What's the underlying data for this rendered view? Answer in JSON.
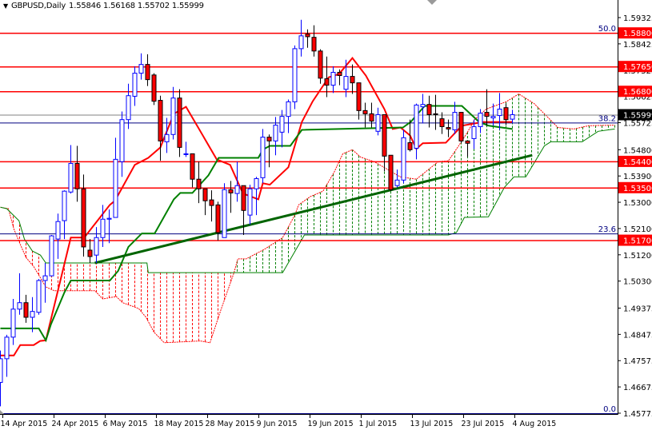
{
  "header": {
    "symbol": "GBPUSD,Daily",
    "ohlc": "1.55846 1.56168 1.55702 1.55999",
    "menu_icon": "triangle-down-icon"
  },
  "colors": {
    "bull_border": "#0000ff",
    "bear_body": "#ff0000",
    "bear_border": "#000000",
    "tenkan": "#ff0000",
    "kijun": "#008000",
    "span_a": "#ff0000",
    "span_b": "#008000",
    "trendline": "#006400",
    "level_line": "#ff0000",
    "fib_line": "#000080",
    "price_line": "#808080",
    "level_label_bg": "#ff0000",
    "current_label_bg": "#000000"
  },
  "chart_data": {
    "type": "candlestick",
    "title": "GBPUSD,Daily",
    "ylim": [
      1.45775,
      1.59925
    ],
    "y_ticks": [
      "1.59325",
      "1.58425",
      "1.57525",
      "1.56625",
      "1.55725",
      "1.54800",
      "1.53900",
      "1.53000",
      "1.52100",
      "1.51200",
      "1.50300",
      "1.49375",
      "1.48475",
      "1.47575",
      "1.46675",
      "1.45775"
    ],
    "x_labels": [
      {
        "index": 0,
        "label": "14 Apr 2015"
      },
      {
        "index": 8,
        "label": "24 Apr 2015"
      },
      {
        "index": 16,
        "label": "6 May 2015"
      },
      {
        "index": 24,
        "label": "18 May 2015"
      },
      {
        "index": 32,
        "label": "28 May 2015"
      },
      {
        "index": 40,
        "label": "9 Jun 2015"
      },
      {
        "index": 48,
        "label": "19 Jun 2015"
      },
      {
        "index": 56,
        "label": "1 Jul 2015"
      },
      {
        "index": 64,
        "label": "13 Jul 2015"
      },
      {
        "index": 72,
        "label": "23 Jul 2015"
      },
      {
        "index": 80,
        "label": "4 Aug 2015"
      }
    ],
    "candles_ohlc": [
      [
        1.4683,
        1.4792,
        1.4601,
        1.4764
      ],
      [
        1.4764,
        1.4846,
        1.4702,
        1.4838
      ],
      [
        1.4838,
        1.4969,
        1.4811,
        1.4934
      ],
      [
        1.4934,
        1.5057,
        1.4915,
        1.4956
      ],
      [
        1.4956,
        1.4983,
        1.4887,
        1.4906
      ],
      [
        1.4906,
        1.4975,
        1.4855,
        1.4926
      ],
      [
        1.4923,
        1.5037,
        1.4915,
        1.5032
      ],
      [
        1.5032,
        1.5092,
        1.4956,
        1.5048
      ],
      [
        1.5048,
        1.5188,
        1.5046,
        1.5185
      ],
      [
        1.5174,
        1.5261,
        1.5106,
        1.5234
      ],
      [
        1.5237,
        1.5341,
        1.5174,
        1.5338
      ],
      [
        1.5335,
        1.5496,
        1.533,
        1.5433
      ],
      [
        1.5433,
        1.5493,
        1.5302,
        1.5346
      ],
      [
        1.5346,
        1.5395,
        1.5114,
        1.5147
      ],
      [
        1.5136,
        1.5174,
        1.5092,
        1.5114
      ],
      [
        1.5119,
        1.5215,
        1.5092,
        1.5179
      ],
      [
        1.5179,
        1.5291,
        1.5147,
        1.5242
      ],
      [
        1.5242,
        1.5275,
        1.516,
        1.5245
      ],
      [
        1.5248,
        1.5521,
        1.5248,
        1.5447
      ],
      [
        1.5439,
        1.5611,
        1.5387,
        1.5583
      ],
      [
        1.5583,
        1.5706,
        1.5551,
        1.5665
      ],
      [
        1.5663,
        1.5766,
        1.563,
        1.5742
      ],
      [
        1.5742,
        1.581,
        1.572,
        1.5772
      ],
      [
        1.5772,
        1.5807,
        1.5698,
        1.572
      ],
      [
        1.5736,
        1.5742,
        1.5633,
        1.5646
      ],
      [
        1.5649,
        1.5665,
        1.5442,
        1.551
      ],
      [
        1.5507,
        1.5589,
        1.5469,
        1.5532
      ],
      [
        1.5532,
        1.5695,
        1.5515,
        1.5657
      ],
      [
        1.5657,
        1.5687,
        1.5455,
        1.5488
      ],
      [
        1.5466,
        1.5507,
        1.5455,
        1.5466
      ],
      [
        1.5466,
        1.5466,
        1.5351,
        1.5379
      ],
      [
        1.5379,
        1.5439,
        1.5297,
        1.5346
      ],
      [
        1.5346,
        1.5346,
        1.5256,
        1.5305
      ],
      [
        1.5308,
        1.5341,
        1.5234,
        1.5289
      ],
      [
        1.5291,
        1.5302,
        1.5169,
        1.5196
      ],
      [
        1.5179,
        1.5365,
        1.5179,
        1.5343
      ],
      [
        1.5343,
        1.5373,
        1.5264,
        1.5332
      ],
      [
        1.533,
        1.5439,
        1.5302,
        1.5357
      ],
      [
        1.5357,
        1.5357,
        1.5188,
        1.5272
      ],
      [
        1.5256,
        1.536,
        1.5223,
        1.5346
      ],
      [
        1.5346,
        1.5387,
        1.5256,
        1.5381
      ],
      [
        1.5384,
        1.5551,
        1.5365,
        1.5523
      ],
      [
        1.5523,
        1.5532,
        1.542,
        1.551
      ],
      [
        1.551,
        1.5592,
        1.5461,
        1.5564
      ],
      [
        1.554,
        1.5616,
        1.5488,
        1.5594
      ],
      [
        1.5594,
        1.5652,
        1.5537,
        1.5644
      ],
      [
        1.5644,
        1.5837,
        1.5619,
        1.5826
      ],
      [
        1.5826,
        1.5925,
        1.5799,
        1.587
      ],
      [
        1.5876,
        1.5892,
        1.5829,
        1.5867
      ],
      [
        1.5865,
        1.5906,
        1.5799,
        1.5818
      ],
      [
        1.5818,
        1.5824,
        1.5706,
        1.5725
      ],
      [
        1.5723,
        1.5799,
        1.566,
        1.5701
      ],
      [
        1.5701,
        1.5766,
        1.5674,
        1.5745
      ],
      [
        1.5745,
        1.5755,
        1.5701,
        1.5734
      ],
      [
        1.5687,
        1.5788,
        1.566,
        1.5731
      ],
      [
        1.5731,
        1.5772,
        1.5671,
        1.5709
      ],
      [
        1.5709,
        1.5709,
        1.5583,
        1.5614
      ],
      [
        1.5614,
        1.5641,
        1.5556,
        1.5603
      ],
      [
        1.5603,
        1.5641,
        1.5556,
        1.5578
      ],
      [
        1.5543,
        1.5624,
        1.5529,
        1.56
      ],
      [
        1.56,
        1.56,
        1.5406,
        1.5458
      ],
      [
        1.5461,
        1.5461,
        1.5338,
        1.5343
      ],
      [
        1.5357,
        1.5412,
        1.5351,
        1.5376
      ],
      [
        1.5376,
        1.5548,
        1.5365,
        1.5521
      ],
      [
        1.5504,
        1.5583,
        1.5474,
        1.548
      ],
      [
        1.5485,
        1.5638,
        1.5447,
        1.5633
      ],
      [
        1.5627,
        1.5671,
        1.557,
        1.5635
      ],
      [
        1.5635,
        1.5665,
        1.5556,
        1.56
      ],
      [
        1.5603,
        1.5668,
        1.5548,
        1.56
      ],
      [
        1.5586,
        1.5608,
        1.5534,
        1.5559
      ],
      [
        1.5556,
        1.5583,
        1.5523,
        1.5551
      ],
      [
        1.5548,
        1.5644,
        1.5534,
        1.5608
      ],
      [
        1.5608,
        1.5608,
        1.5502,
        1.551
      ],
      [
        1.551,
        1.551,
        1.5455,
        1.5502
      ],
      [
        1.5518,
        1.5583,
        1.5482,
        1.5559
      ],
      [
        1.5559,
        1.5619,
        1.5537,
        1.5605
      ],
      [
        1.5608,
        1.5687,
        1.5562,
        1.5594
      ],
      [
        1.5589,
        1.5638,
        1.5562,
        1.5594
      ],
      [
        1.5597,
        1.5674,
        1.5548,
        1.5619
      ],
      [
        1.5624,
        1.5638,
        1.5564,
        1.5583
      ],
      [
        1.55846,
        1.56168,
        1.55702,
        1.55999
      ]
    ],
    "tenkan_sen": [
      [
        0,
        1.4775
      ],
      [
        2.1,
        1.4775
      ],
      [
        3.1,
        1.4811
      ],
      [
        5.2,
        1.4811
      ],
      [
        6.2,
        1.4825
      ],
      [
        7.1,
        1.4827
      ],
      [
        11,
        1.5179
      ],
      [
        13.1,
        1.5179
      ],
      [
        17.1,
        1.5291
      ],
      [
        17.9,
        1.5305
      ],
      [
        21,
        1.5428
      ],
      [
        23.1,
        1.5452
      ],
      [
        25,
        1.5488
      ],
      [
        27.1,
        1.5603
      ],
      [
        29,
        1.5627
      ],
      [
        30.9,
        1.5556
      ],
      [
        33.8,
        1.5447
      ],
      [
        35.9,
        1.5428
      ],
      [
        37.9,
        1.533
      ],
      [
        40.3,
        1.531
      ],
      [
        41,
        1.5365
      ],
      [
        42.1,
        1.536
      ],
      [
        45,
        1.542
      ],
      [
        47.1,
        1.5575
      ],
      [
        48.8,
        1.5646
      ],
      [
        51.3,
        1.5728
      ],
      [
        52.9,
        1.5739
      ],
      [
        55,
        1.5794
      ],
      [
        57.1,
        1.5734
      ],
      [
        60,
        1.5619
      ],
      [
        61.3,
        1.5551
      ],
      [
        62.5,
        1.5556
      ],
      [
        64,
        1.5529
      ],
      [
        65,
        1.5483
      ],
      [
        66,
        1.5502
      ],
      [
        69.6,
        1.5504
      ],
      [
        72.1,
        1.5562
      ],
      [
        75.4,
        1.5575
      ],
      [
        80,
        1.5575
      ]
    ],
    "kijun_sen": [
      [
        0,
        1.4868
      ],
      [
        6,
        1.4868
      ],
      [
        7.1,
        1.4827
      ],
      [
        7.9,
        1.4882
      ],
      [
        10,
        1.4991
      ],
      [
        11,
        1.5032
      ],
      [
        17.1,
        1.5032
      ],
      [
        18.4,
        1.5065
      ],
      [
        20,
        1.5147
      ],
      [
        22.1,
        1.5193
      ],
      [
        24.1,
        1.5193
      ],
      [
        27.1,
        1.531
      ],
      [
        28.1,
        1.5332
      ],
      [
        30,
        1.5332
      ],
      [
        32.5,
        1.5392
      ],
      [
        34.1,
        1.5452
      ],
      [
        40.3,
        1.5452
      ],
      [
        41,
        1.548
      ],
      [
        42.1,
        1.5493
      ],
      [
        45.3,
        1.5493
      ],
      [
        47.1,
        1.5548
      ],
      [
        62.9,
        1.5556
      ],
      [
        64.1,
        1.5575
      ],
      [
        66.3,
        1.563
      ],
      [
        72.1,
        1.563
      ],
      [
        74.8,
        1.5575
      ],
      [
        76.3,
        1.5562
      ],
      [
        80,
        1.5551
      ]
    ],
    "senkou_span_a": [
      [
        0,
        1.5283
      ],
      [
        1.25,
        1.5278
      ],
      [
        2.1,
        1.5209
      ],
      [
        2.9,
        1.5166
      ],
      [
        4,
        1.5111
      ],
      [
        5.25,
        1.5078
      ],
      [
        7.1,
        1.501
      ],
      [
        8.4,
        1.4997
      ],
      [
        14.75,
        1.4997
      ],
      [
        16,
        1.4969
      ],
      [
        18.1,
        1.4977
      ],
      [
        19.1,
        1.4956
      ],
      [
        20.25,
        1.4947
      ],
      [
        21.6,
        1.4936
      ],
      [
        22.75,
        1.4906
      ],
      [
        24,
        1.4855
      ],
      [
        25.6,
        1.4819
      ],
      [
        31.25,
        1.4825
      ],
      [
        32.75,
        1.4819
      ],
      [
        34.4,
        1.4928
      ],
      [
        36.5,
        1.5059
      ],
      [
        37.1,
        1.5106
      ],
      [
        38.4,
        1.5106
      ],
      [
        41.25,
        1.5139
      ],
      [
        44.1,
        1.5179
      ],
      [
        46,
        1.5256
      ],
      [
        46.6,
        1.5291
      ],
      [
        48.4,
        1.5319
      ],
      [
        50.4,
        1.5338
      ],
      [
        52.1,
        1.5401
      ],
      [
        53.5,
        1.5466
      ],
      [
        55,
        1.548
      ],
      [
        56.25,
        1.5455
      ],
      [
        58.4,
        1.5439
      ],
      [
        62.5,
        1.5387
      ],
      [
        65,
        1.5379
      ],
      [
        68.4,
        1.5439
      ],
      [
        70,
        1.5442
      ],
      [
        71.6,
        1.5493
      ],
      [
        72.9,
        1.5537
      ],
      [
        74.1,
        1.5583
      ],
      [
        75.9,
        1.5619
      ],
      [
        79,
        1.5644
      ],
      [
        81,
        1.5671
      ],
      [
        83.4,
        1.5638
      ],
      [
        85.9,
        1.5583
      ],
      [
        87.1,
        1.5556
      ],
      [
        89.6,
        1.5551
      ],
      [
        91.9,
        1.5562
      ],
      [
        96,
        1.5564
      ]
    ],
    "senkou_span_b": [
      [
        0,
        1.5283
      ],
      [
        1,
        1.5278
      ],
      [
        2.9,
        1.5237
      ],
      [
        3.75,
        1.5174
      ],
      [
        5,
        1.5133
      ],
      [
        6.25,
        1.5119
      ],
      [
        7.1,
        1.5092
      ],
      [
        22.9,
        1.5092
      ],
      [
        23.1,
        1.5059
      ],
      [
        44.1,
        1.5059
      ],
      [
        47.5,
        1.5188
      ],
      [
        70,
        1.5188
      ],
      [
        71.25,
        1.5196
      ],
      [
        72.5,
        1.5248
      ],
      [
        76.25,
        1.525
      ],
      [
        78.75,
        1.5351
      ],
      [
        80.25,
        1.5387
      ],
      [
        82.1,
        1.5387
      ],
      [
        85,
        1.5493
      ],
      [
        86,
        1.5507
      ],
      [
        90.9,
        1.5507
      ],
      [
        93.4,
        1.5543
      ],
      [
        96,
        1.5551
      ]
    ],
    "trendline": [
      [
        14.75,
        1.5092
      ],
      [
        83.1,
        1.5461
      ]
    ],
    "horizontal_levels": [
      {
        "price": 1.588,
        "label": "1.58800"
      },
      {
        "price": 1.5765,
        "label": "1.57650"
      },
      {
        "price": 1.568,
        "label": "1.56800"
      },
      {
        "price": 1.544,
        "label": "1.54400"
      },
      {
        "price": 1.535,
        "label": "1.53500"
      },
      {
        "price": 1.517,
        "label": "1.51700"
      }
    ],
    "fibonacci_levels": [
      {
        "price": 1.588,
        "label": "50.0"
      },
      {
        "price": 1.5573,
        "label": "38.2"
      },
      {
        "price": 1.5193,
        "label": "23.6"
      },
      {
        "price": 1.45775,
        "label": "0.0"
      }
    ],
    "current_price": {
      "price": 1.55999,
      "label": "1.55999"
    }
  }
}
